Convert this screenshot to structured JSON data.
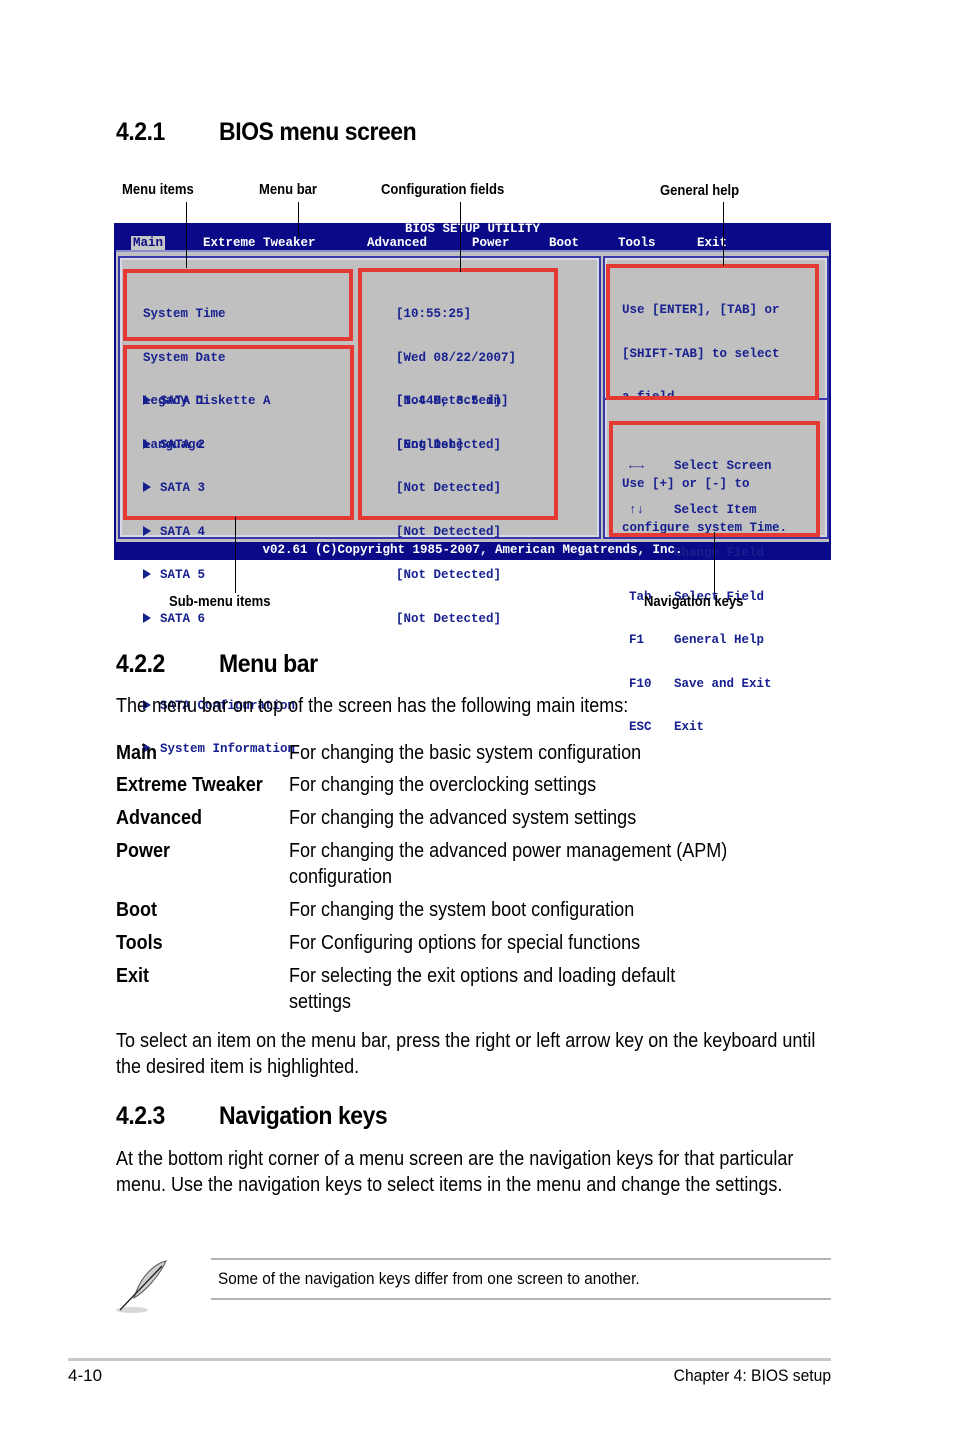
{
  "section_421": {
    "number": "4.2.1",
    "title": "BIOS menu screen"
  },
  "callouts": {
    "menu_items": "Menu items",
    "menu_bar": "Menu bar",
    "config_fields": "Configuration fields",
    "general_help": "General help",
    "sub_menu_items": "Sub-menu items",
    "navigation_keys": "Navigation keys"
  },
  "bios": {
    "title": "BIOS SETUP UTILITY",
    "menu": [
      "Main",
      "Extreme Tweaker",
      "Advanced",
      "Power",
      "Boot",
      "Tools",
      "Exit"
    ],
    "active_menu": "Main",
    "items": [
      "System Time",
      "System Date",
      "Legacy Diskette A",
      "Language"
    ],
    "values": [
      "[10:55:25]",
      "[Wed 08/22/2007]",
      "[1.44M, 3.5 in]",
      "[English]"
    ],
    "submenus": [
      "SATA 1",
      "SATA 2",
      "SATA 3",
      "SATA 4",
      "SATA 5",
      "SATA 6",
      "SATA Configuration",
      "System Information"
    ],
    "submenu_values": [
      "[Not Detected]",
      "[Not Detected]",
      "[Not Detected]",
      "[Not Detected]",
      "[Not Detected]",
      "[Not Detected]"
    ],
    "help_lines": [
      "Use [ENTER], [TAB] or",
      "[SHIFT-TAB] to select",
      "a field.",
      "",
      "Use [+] or [-] to",
      "configure system Time."
    ],
    "nav_keys": [
      {
        "key": "←→",
        "action": "Select Screen",
        "icon": "left-right-arrows-icon"
      },
      {
        "key": "↑↓",
        "action": "Select Item",
        "icon": "up-down-arrows-icon"
      },
      {
        "key": "+-",
        "action": "Change Field"
      },
      {
        "key": "Tab",
        "action": "Select Field"
      },
      {
        "key": "F1",
        "action": "General Help"
      },
      {
        "key": "F10",
        "action": "Save and Exit"
      },
      {
        "key": "ESC",
        "action": "Exit"
      }
    ],
    "footer": "v02.61 (C)Copyright 1985-2007, American Megatrends, Inc.",
    "colors": {
      "background": "#0a0a88",
      "panel": "#c0c0c0",
      "text": "#17208f",
      "highlight": "#e53a33"
    }
  },
  "section_422": {
    "number": "4.2.2",
    "title": "Menu bar",
    "intro": "The menu bar on top of the screen has the following main items:",
    "definitions": [
      {
        "term": "Main",
        "desc": "For changing the basic system configuration"
      },
      {
        "term": "Extreme Tweaker",
        "desc": "For changing the overclocking settings"
      },
      {
        "term": "Advanced",
        "desc": "For changing the advanced system settings"
      },
      {
        "term": "Power",
        "desc": "For changing the advanced power management (APM) configuration"
      },
      {
        "term": "Boot",
        "desc": "For changing the system boot configuration"
      },
      {
        "term": "Tools",
        "desc": "For Configuring options for special functions"
      },
      {
        "term": "Exit",
        "desc": "For selecting the exit options and loading default settings"
      }
    ],
    "outro": "To select an item on the menu bar, press the right or left arrow key on the keyboard until the desired item is highlighted."
  },
  "section_423": {
    "number": "4.2.3",
    "title": "Navigation keys",
    "body": "At the bottom right corner of a menu screen are the navigation keys for that particular menu. Use the navigation keys to select items in the menu and change the settings."
  },
  "note": {
    "icon": "feather-quill-icon",
    "text": "Some of the navigation keys differ from one screen to another."
  },
  "footer": {
    "page": "4-10",
    "chapter": "Chapter 4: BIOS setup"
  }
}
